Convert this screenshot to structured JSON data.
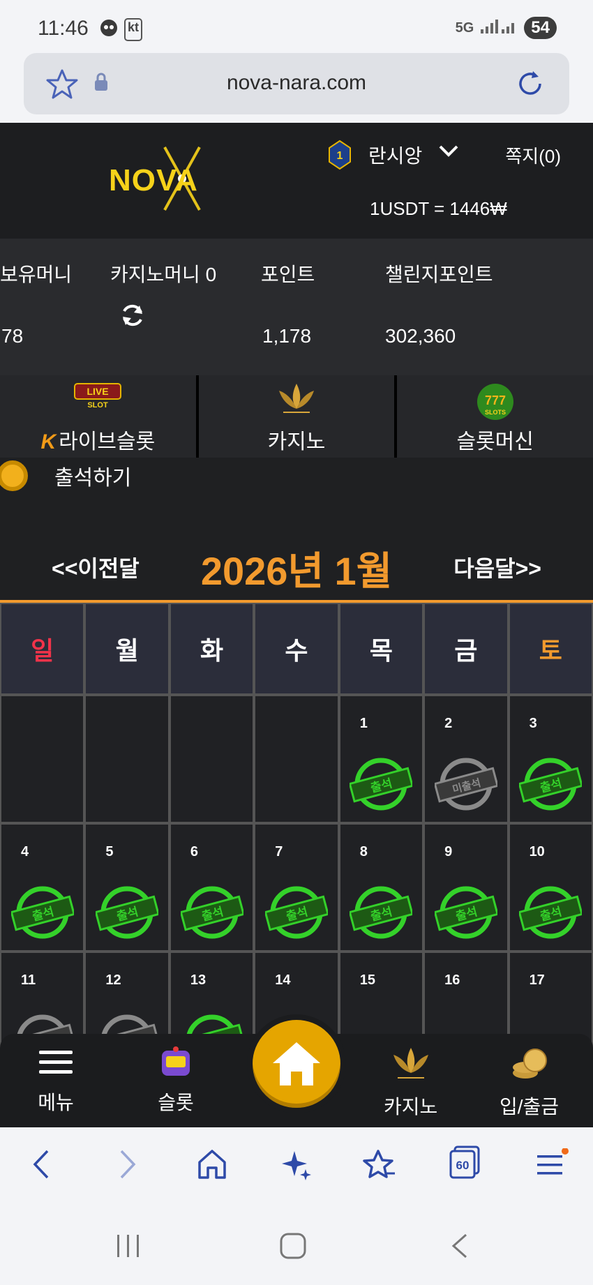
{
  "status_bar": {
    "time": "11:46",
    "carrier": "kt",
    "network": "5G",
    "battery": "54"
  },
  "browser": {
    "url": "nova-nara.com",
    "tab_count": "60"
  },
  "header": {
    "logo_text": "NOVA",
    "rank": "1",
    "username": "란시앙",
    "messages": "쪽지(0)",
    "exchange_rate": "1USDT = 1446₩"
  },
  "money": {
    "held_label": "보유머니",
    "held_value": "78",
    "casino_label": "카지노머니 0",
    "points_label": "포인트",
    "points_value": "1,178",
    "challenge_label": "챌린지포인트",
    "challenge_value": "302,360"
  },
  "tabs": [
    {
      "label": "라이브슬롯",
      "prefix": "K",
      "icon": "live-slot-icon"
    },
    {
      "label": "카지노",
      "icon": "k-slot-lotus-icon"
    },
    {
      "label": "슬롯머신",
      "icon": "777-slots-icon"
    }
  ],
  "attendance": {
    "label": "출석하기",
    "prev": "<<이전달",
    "title": "2026년 1월",
    "next": "다음달>>"
  },
  "weekdays": [
    "일",
    "월",
    "화",
    "수",
    "목",
    "금",
    "토"
  ],
  "calendar": {
    "attended_stamp": "출석",
    "missed_stamp": "미출석",
    "days": [
      {
        "day": "1",
        "status": "attended"
      },
      {
        "day": "2",
        "status": "missed"
      },
      {
        "day": "3",
        "status": "attended"
      },
      {
        "day": "4",
        "status": "attended"
      },
      {
        "day": "5",
        "status": "attended"
      },
      {
        "day": "6",
        "status": "attended"
      },
      {
        "day": "7",
        "status": "attended"
      },
      {
        "day": "8",
        "status": "attended"
      },
      {
        "day": "9",
        "status": "attended"
      },
      {
        "day": "10",
        "status": "attended"
      },
      {
        "day": "11",
        "status": "missed"
      },
      {
        "day": "12",
        "status": "missed"
      },
      {
        "day": "13",
        "status": "attended"
      },
      {
        "day": "14",
        "status": "loading"
      },
      {
        "day": "15",
        "status": "none"
      },
      {
        "day": "16",
        "status": "none"
      },
      {
        "day": "17",
        "status": "none"
      }
    ]
  },
  "bottom_nav": {
    "menu": "메뉴",
    "slot": "슬롯",
    "casino": "카지노",
    "deposit": "입/출금"
  },
  "colors": {
    "accent": "#f29a2e",
    "stamp_green": "#34d12a",
    "stamp_gray": "#8a8a8a",
    "sunday": "#f2334a"
  }
}
